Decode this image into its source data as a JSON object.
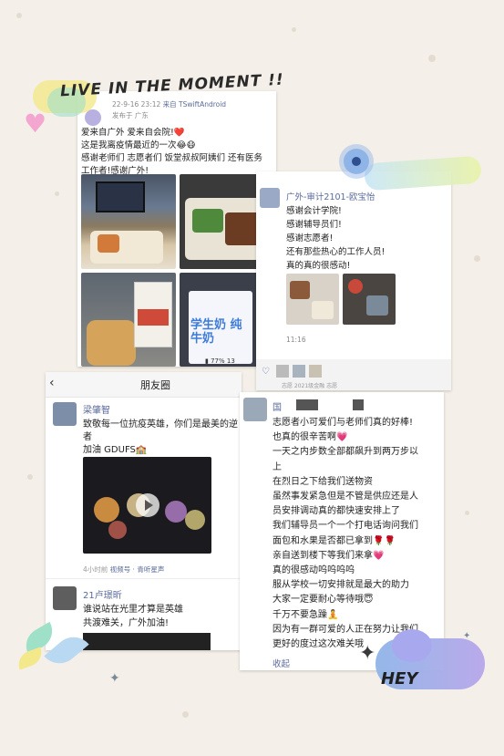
{
  "title_sticker": "LIVE IN THE  MOMENT !!",
  "hey_sticker": "HEY",
  "post1": {
    "meta_time": "22-9-16 23:12",
    "meta_source": "来自 TSwiftAndroid",
    "meta_location": "发布于 广东",
    "lines": [
      "爱来自广外 爱来自会院!❤️",
      "这是我离疫情最近的一次😂😷",
      "感谢老师们 志愿者们 饭堂叔叔阿姨们 还有医务",
      "工作者!感谢广外!"
    ],
    "milk_box_text": "学生奶 纯牛奶",
    "status_battery": "77%",
    "status_time": "13"
  },
  "post2": {
    "author": "广外-审计2101-欧宝怡",
    "lines": [
      "感谢会计学院!",
      "感谢辅导员们!",
      "感谢志愿者!",
      "还有那些热心的工作人员!",
      "真的真的很感动!"
    ],
    "time": "11:16",
    "footer_text": "志愿 2021级金融 志愿"
  },
  "moments": {
    "back_icon": "back-arrow",
    "title": "朋友圈",
    "item1": {
      "name": "梁肇智",
      "text_line1": "致敬每一位抗疫英雄，你们是最美的逆",
      "text_line2": "者",
      "text_line3": "加油 GDUFS🏫",
      "meta_time": "4小时前",
      "meta_channel": "视频号 · 青听星声"
    },
    "item2": {
      "name": "21卢璟昕",
      "text_line1": "谁说站在光里才算是英雄",
      "text_line2": "共渡难关，广外加油!"
    }
  },
  "post3": {
    "name": "国",
    "lines": [
      "志愿者小可爱们与老师们真的好棒!",
      "也真的很辛苦啊💗",
      "一天之内步数全部都飙升到两万步以",
      "上",
      "在烈日之下给我们送物资",
      "虽然事发紧急但是不管是供应还是人",
      "员安排调动真的都快速安排上了",
      "我们辅导员一个一个打电话询问我们",
      "面包和水果是否都已拿到🌹🌹",
      "亲自送到楼下等我们来拿💗",
      "真的很感动呜呜呜呜",
      "服从学校一切安排就是最大的助力",
      "大家一定要耐心等待哦😇",
      "千万不要急躁🧘",
      "因为有一群可爱的人正在努力让我们",
      "更好的度过这次难关哦"
    ],
    "collapse": "收起"
  },
  "colors": {
    "background": "#f4efe8",
    "sticker_blue": "#8fb4e8",
    "sticker_purple": "#b7a6ea",
    "sticker_yellow": "#f3e88a",
    "sticker_pink": "#f3a6cf"
  }
}
